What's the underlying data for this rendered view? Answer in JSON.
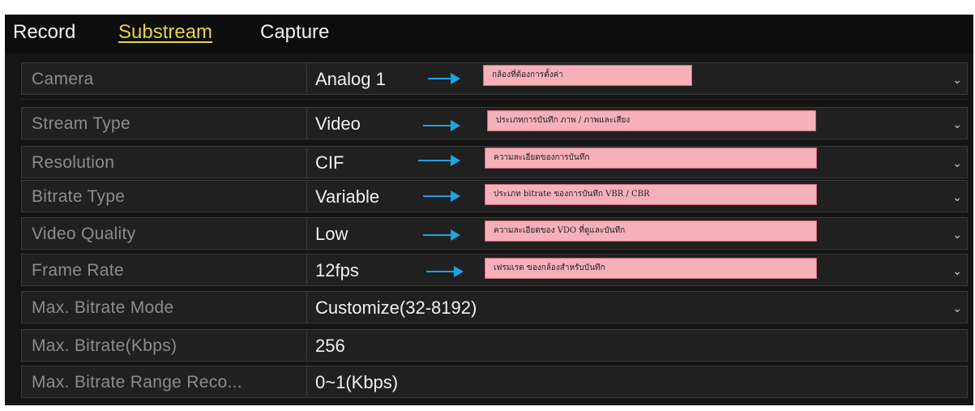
{
  "tabs": {
    "record": "Record",
    "substream": "Substream",
    "capture": "Capture"
  },
  "fields": {
    "camera": {
      "label": "Camera",
      "value": "Analog 1",
      "note": "กล้องที่ต้องการตั้งค่า"
    },
    "stream_type": {
      "label": "Stream Type",
      "value": "Video",
      "note": "ประเภทการบันทึก ภาพ / ภาพและเสียง"
    },
    "resolution": {
      "label": "Resolution",
      "value": "CIF",
      "note": "ความละเอียดของการบันทึก"
    },
    "bitrate_type": {
      "label": "Bitrate Type",
      "value": "Variable",
      "note": "ประเภท bitrate ของการบันทึก VBR / CBR"
    },
    "video_quality": {
      "label": "Video Quality",
      "value": "Low",
      "note": "ความละเอียดของ VDO ที่ดูและบันทึก"
    },
    "frame_rate": {
      "label": "Frame Rate",
      "value": "12fps",
      "note": "เฟรมเรต ของกล้องสำหรับบันทึก"
    },
    "max_bitrate_mode": {
      "label": "Max. Bitrate Mode",
      "value": "Customize(32-8192)"
    },
    "max_bitrate": {
      "label": "Max. Bitrate(Kbps)",
      "value": "256"
    },
    "max_bitrate_range": {
      "label": "Max. Bitrate Range Reco...",
      "value": "0~1(Kbps)"
    }
  },
  "icons": {
    "dropdown": "chevron-down-icon",
    "annotation_arrow": "arrow-right-icon"
  },
  "colors": {
    "accent_tab": "#e6d34a",
    "arrow": "#21a3e0",
    "note_bg": "#f5b0ba",
    "panel_bg": "#141414"
  }
}
